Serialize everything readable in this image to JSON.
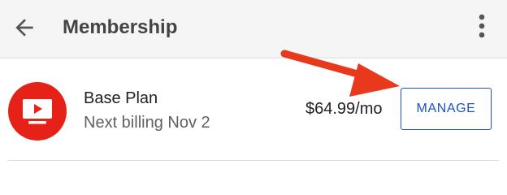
{
  "header": {
    "title": "Membership",
    "back_icon": "arrow-left-icon",
    "more_icon": "more-vert-icon",
    "background": "#f5f5f5"
  },
  "plan": {
    "icon": "youtube-tv-icon",
    "icon_color": "#e62117",
    "name": "Base Plan",
    "billing": "Next billing Nov 2",
    "price": "$64.99/mo",
    "manage_label": "MANAGE",
    "accent": "#1a52c4"
  },
  "annotation": {
    "arrow_color": "#e8391c"
  }
}
